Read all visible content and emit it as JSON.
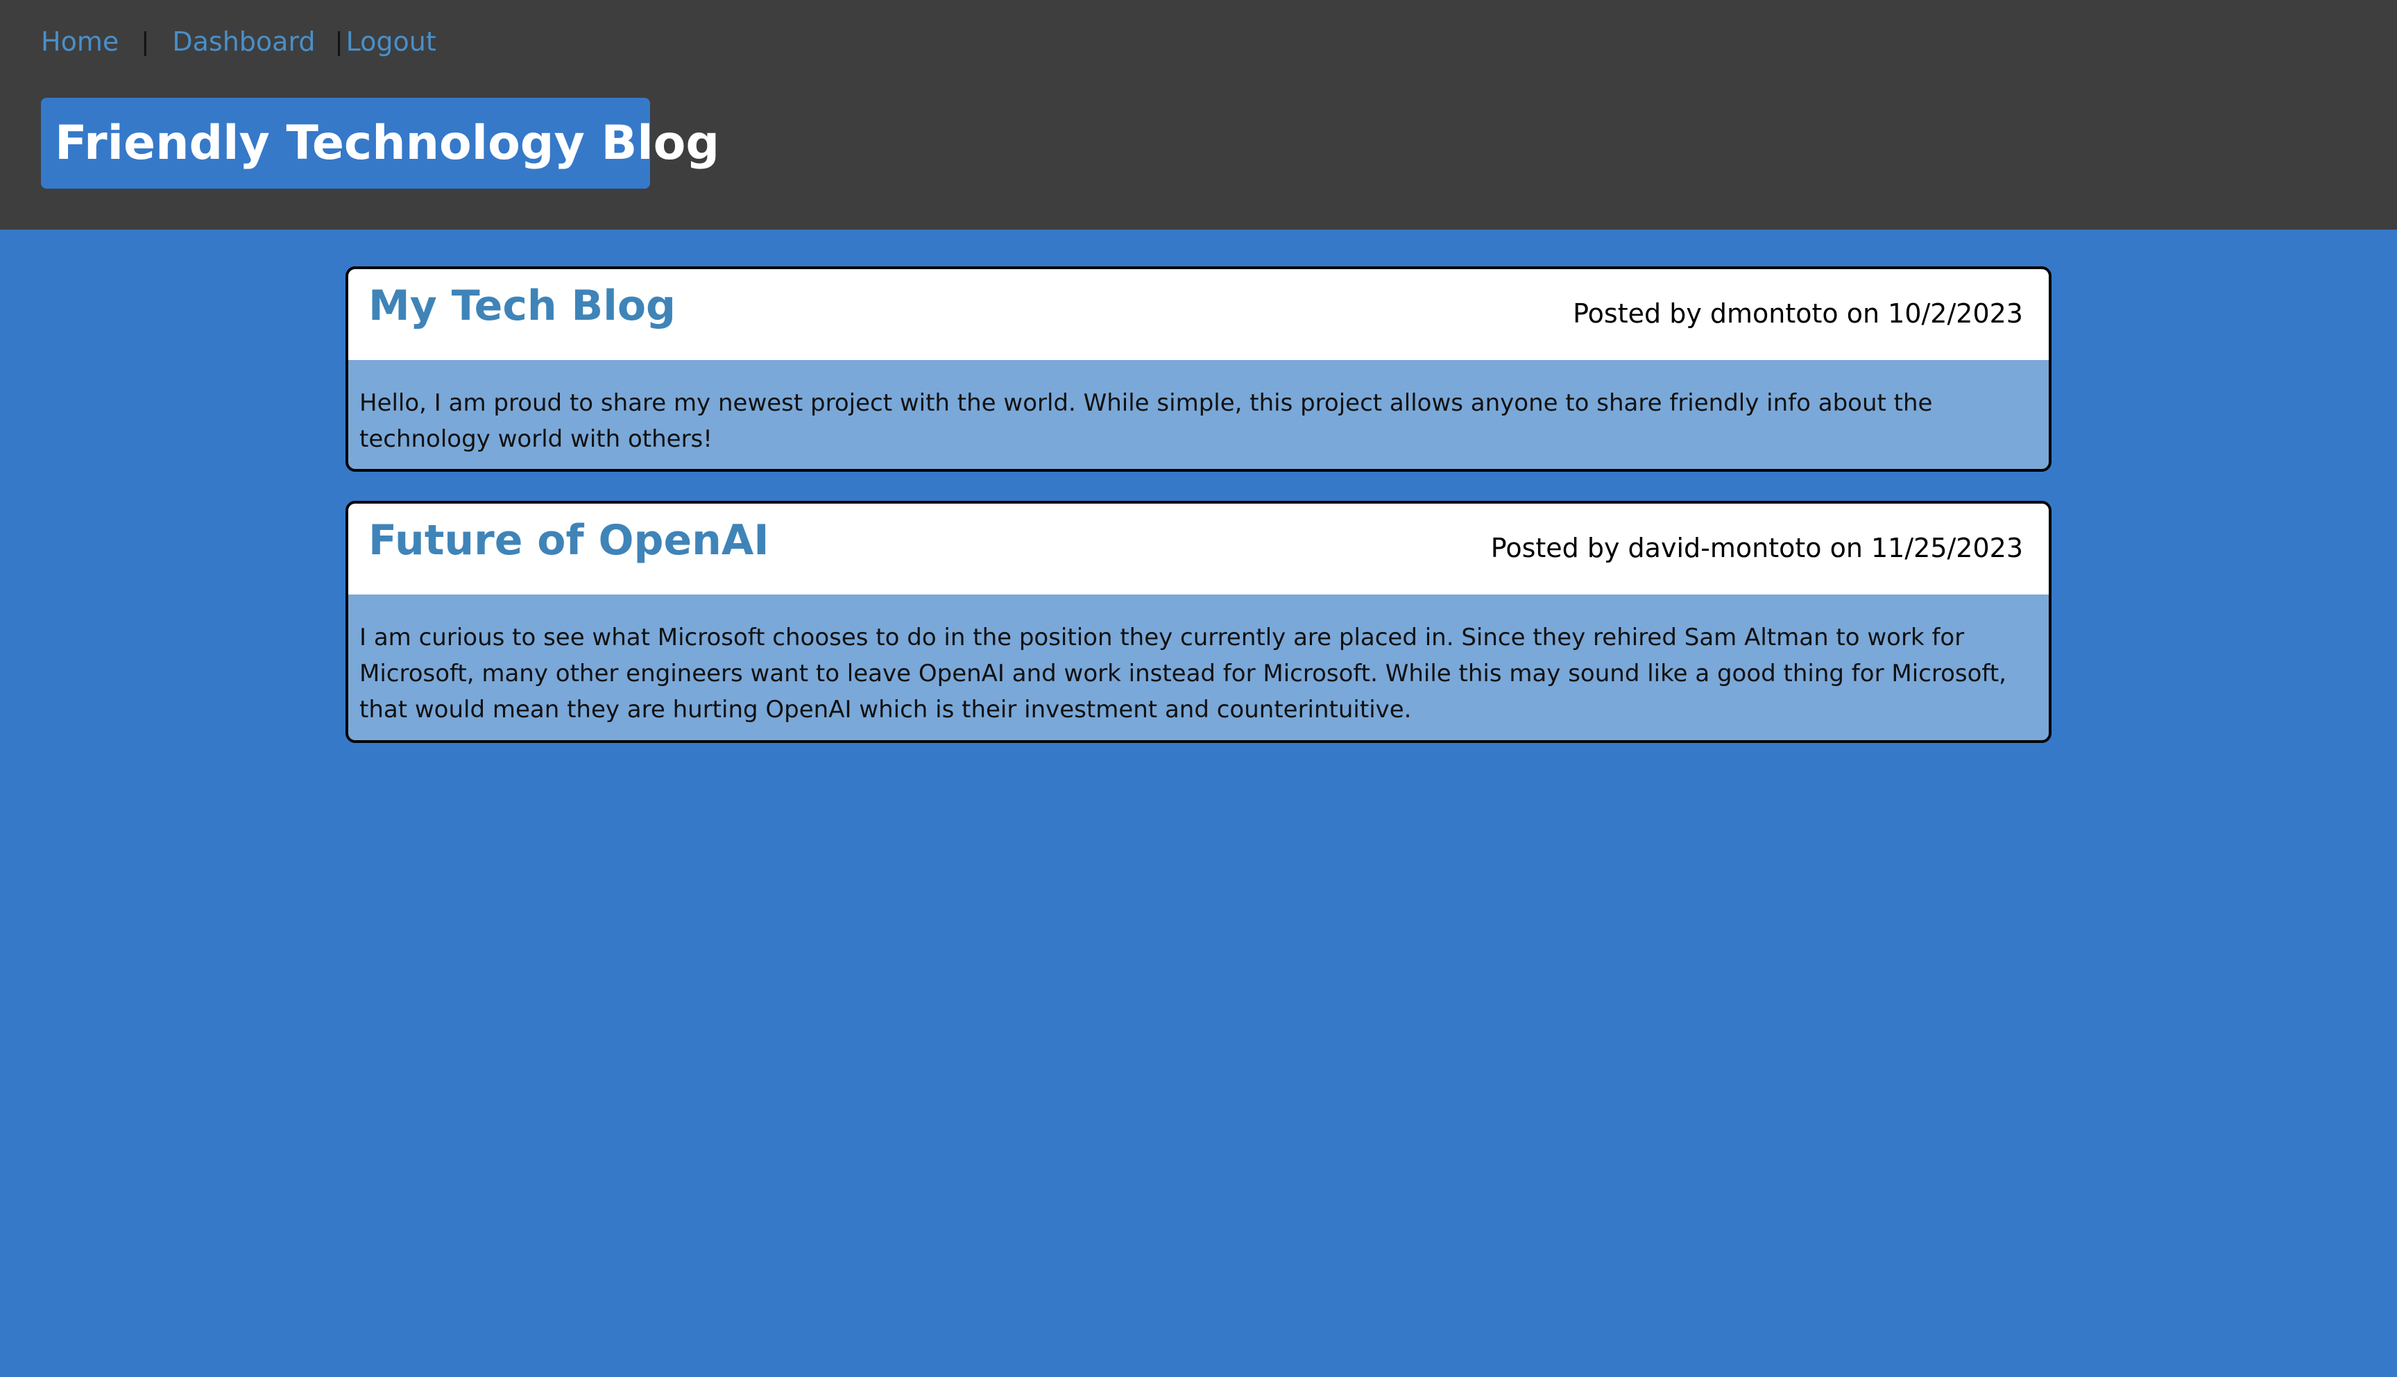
{
  "nav": {
    "home": "Home",
    "separator": "|",
    "dashboard": "Dashboard",
    "logout": "Logout"
  },
  "brand": {
    "title": "Friendly Technology Blog"
  },
  "posts": [
    {
      "title": "My Tech Blog",
      "meta": "Posted by dmontoto on 10/2/2023",
      "body": "Hello, I am proud to share my newest project with the world. While simple, this project allows anyone to share friendly info about the technology world with others!"
    },
    {
      "title": "Future of OpenAI",
      "meta": "Posted by david-montoto on 11/25/2023",
      "body": "I am curious to see what Microsoft chooses to do in the position they currently are placed in. Since they rehired Sam Altman to work for Microsoft, many other engineers want to leave OpenAI and work instead for Microsoft. While this may sound like a good thing for Microsoft, that would mean they are hurting OpenAI which is their investment and counterintuitive."
    }
  ],
  "colors": {
    "header_bg": "#3e3e3e",
    "page_bg": "#3679c9",
    "link": "#4a8fc9",
    "post_title": "#3f84b8",
    "post_body_bg": "#7aa8d8"
  }
}
